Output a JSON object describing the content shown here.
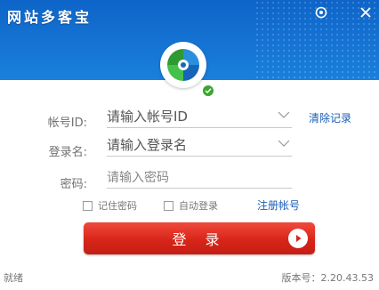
{
  "window": {
    "title": "网站多客宝",
    "settings_icon": "settings-icon",
    "close_icon": "close-icon"
  },
  "form": {
    "account_id": {
      "label": "帐号ID:",
      "placeholder": "请输入帐号ID",
      "action": "清除记录"
    },
    "login_name": {
      "label": "登录名:",
      "placeholder": "请输入登录名"
    },
    "password": {
      "label": "密码:",
      "placeholder": "请输入密码"
    },
    "remember_password": "记住密码",
    "auto_login": "自动登录",
    "register": "注册帐号",
    "login_button": "登 录"
  },
  "status_bar": {
    "status": "就绪",
    "version": "版本号：2.20.43.53"
  },
  "colors": {
    "header": "#1a78d6",
    "login_button": "#d82519",
    "link": "#1a5fb4"
  }
}
